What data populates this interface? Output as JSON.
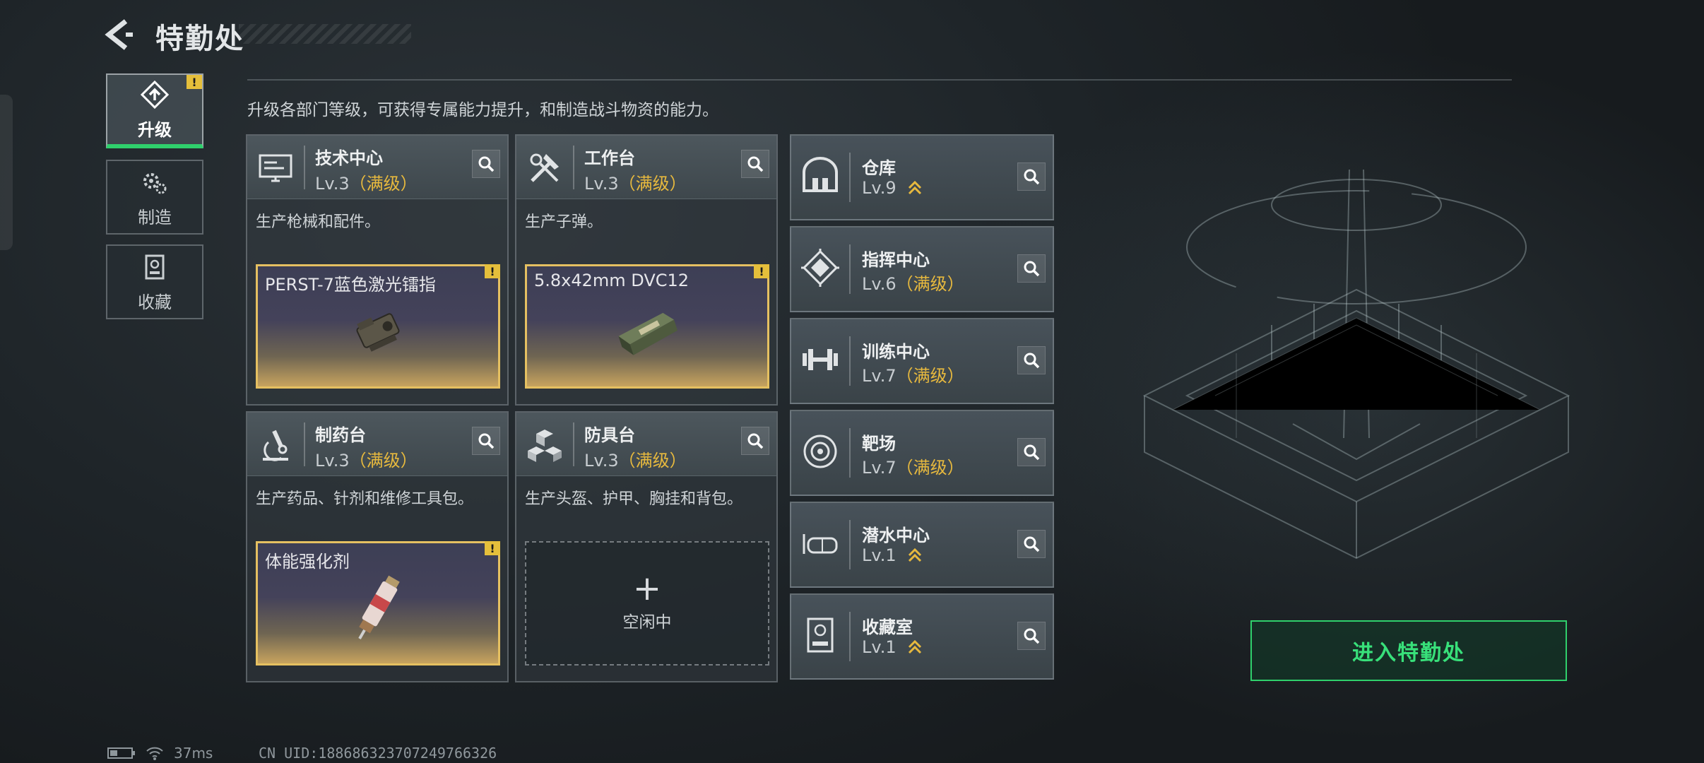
{
  "header": {
    "title": "特勤处"
  },
  "sidebar": {
    "items": [
      {
        "label": "升级",
        "icon": "upgrade-icon",
        "active": true,
        "alert": "!"
      },
      {
        "label": "制造",
        "icon": "gears-icon",
        "active": false
      },
      {
        "label": "收藏",
        "icon": "collection-icon",
        "active": false
      }
    ]
  },
  "description": "升级各部门等级，可获得专属能力提升，和制造战斗物资的能力。",
  "facilities": [
    {
      "name": "技术中心",
      "level": "Lv.3",
      "max": "（满级）",
      "icon": "monitor-icon",
      "desc": "生产枪械和配件。",
      "slot": {
        "type": "item",
        "name": "PERST-7蓝色激光镭指",
        "alert": "!"
      }
    },
    {
      "name": "工作台",
      "level": "Lv.3",
      "max": "（满级）",
      "icon": "tools-icon",
      "desc": "生产子弹。",
      "slot": {
        "type": "item",
        "name": "5.8x42mm DVC12",
        "alert": "!"
      }
    },
    {
      "name": "制药台",
      "level": "Lv.3",
      "max": "（满级）",
      "icon": "microscope-icon",
      "desc": "生产药品、针剂和维修工具包。",
      "slot": {
        "type": "item",
        "name": "体能强化剂",
        "alert": "!"
      }
    },
    {
      "name": "防具台",
      "level": "Lv.3",
      "max": "（满级）",
      "icon": "armor-cubes-icon",
      "desc": "生产头盔、护甲、胸挂和背包。",
      "slot": {
        "type": "idle",
        "plus": "+",
        "label": "空闲中"
      }
    }
  ],
  "buildings": [
    {
      "name": "仓库",
      "level": "Lv.9",
      "max": "",
      "upgradable": true,
      "icon": "warehouse-icon"
    },
    {
      "name": "指挥中心",
      "level": "Lv.6",
      "max": "（满级）",
      "upgradable": false,
      "icon": "command-chip-icon"
    },
    {
      "name": "训练中心",
      "level": "Lv.7",
      "max": "（满级）",
      "upgradable": false,
      "icon": "dumbbell-icon"
    },
    {
      "name": "靶场",
      "level": "Lv.7",
      "max": "（满级）",
      "upgradable": false,
      "icon": "target-icon"
    },
    {
      "name": "潜水中心",
      "level": "Lv.1",
      "max": "",
      "upgradable": true,
      "icon": "dive-mask-icon"
    },
    {
      "name": "收藏室",
      "level": "Lv.1",
      "max": "",
      "upgradable": true,
      "icon": "trophy-case-icon"
    }
  ],
  "enter_button": "进入特勤处",
  "status": {
    "ping": "37ms",
    "uid": "CN UID:188686323707249766326"
  },
  "colors": {
    "accent_green": "#2fd06c",
    "max_level_gold": "#e7b93e",
    "alert_yellow": "#e5bf3b"
  }
}
